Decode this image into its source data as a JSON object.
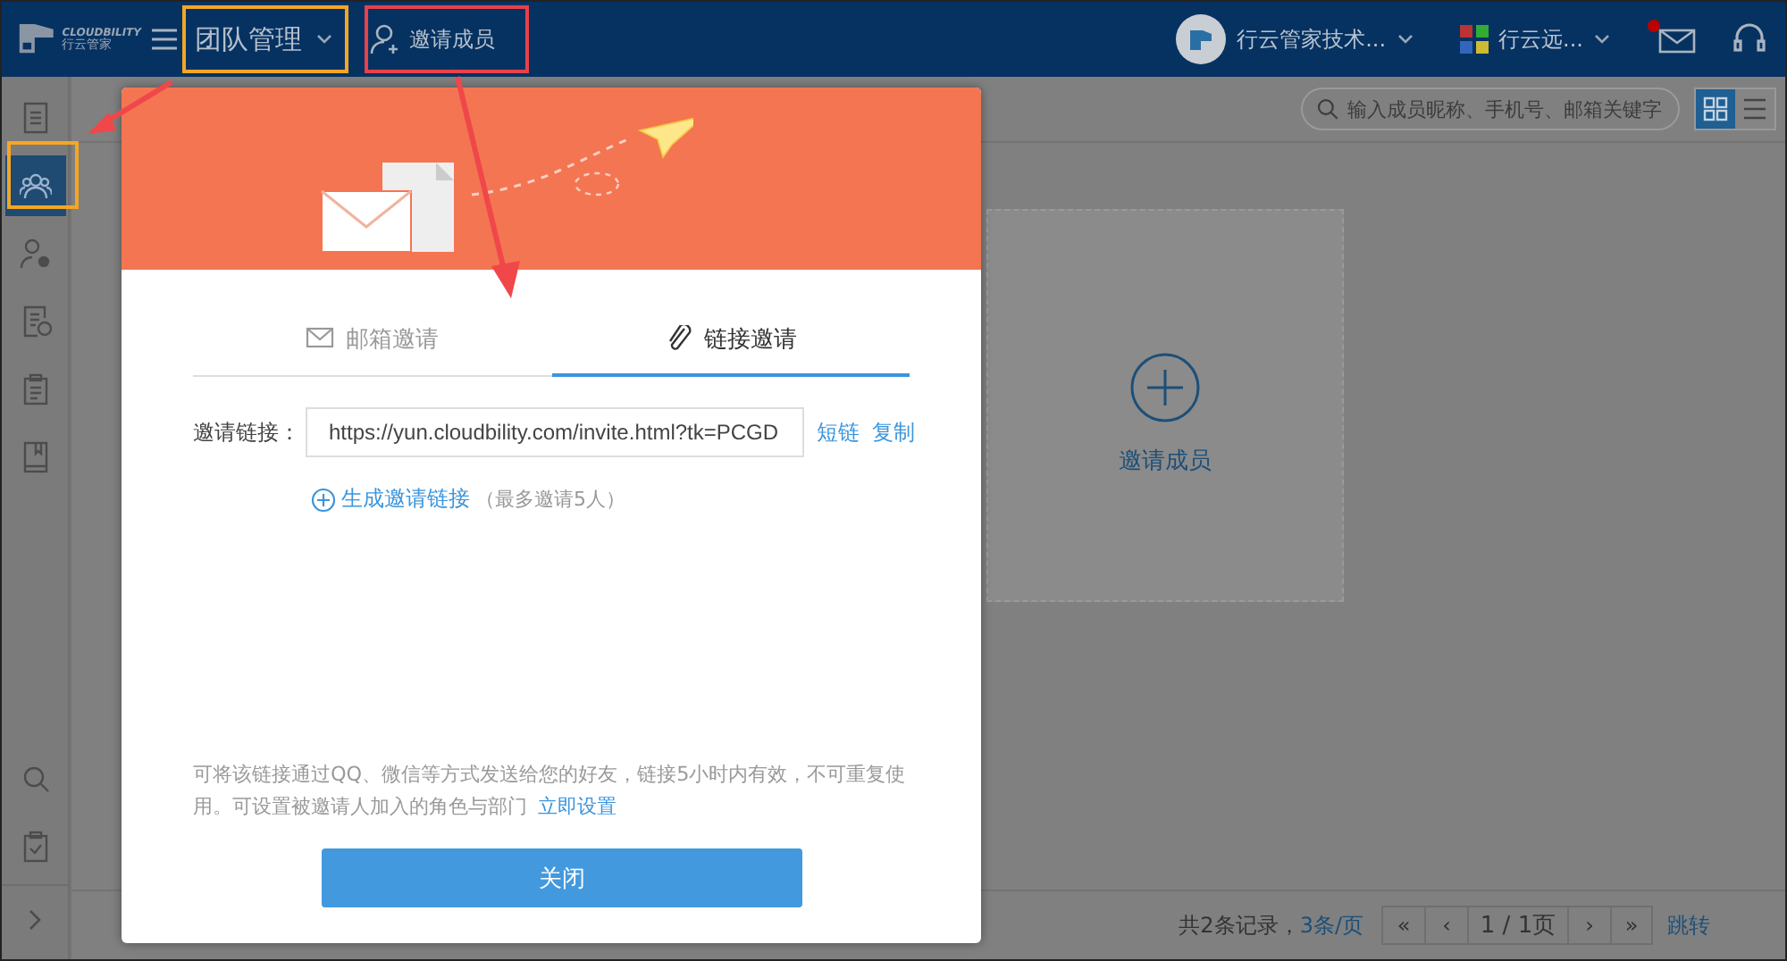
{
  "header": {
    "logo_text": "CLOUDBILITY",
    "logo_subtext": "行云管家",
    "module": "团队管理",
    "action": "邀请成员",
    "account": "行云管家技术...",
    "org": "行云远...",
    "unread": true
  },
  "sidebar": {
    "items": [
      {
        "selected": false
      },
      {
        "selected": true
      },
      {
        "selected": false
      },
      {
        "selected": false
      },
      {
        "selected": false
      },
      {
        "selected": false
      }
    ]
  },
  "toolbar": {
    "search_placeholder": "输入成员昵称、手机号、邮箱关键字",
    "views": [
      {
        "selected": true
      },
      {
        "selected": false
      }
    ]
  },
  "card": {
    "label": "邀请成员"
  },
  "modal": {
    "tabs": [
      {
        "label": "邮箱邀请",
        "selected": false
      },
      {
        "label": "链接邀请",
        "selected": true
      }
    ],
    "link_label": "邀请链接：",
    "link_value": "https://yun.cloudbility.com/invite.html?tk=PCGD",
    "short_link": "短链",
    "copy": "复制",
    "generate": "生成邀请链接",
    "generate_note": "（最多邀请5人）",
    "note": "可将该链接通过QQ、微信等方式发送给您的好友，链接5小时内有效，不可重复使用。可设置被邀请人加入的角色与部门",
    "note_link": "立即设置",
    "close": "关闭"
  },
  "pagination": {
    "summary": "共2条记录，",
    "page_size": "3条/页",
    "buttons": [
      "«",
      "‹",
      "1 / 1页",
      "›",
      "»"
    ],
    "jump": "跳转"
  }
}
